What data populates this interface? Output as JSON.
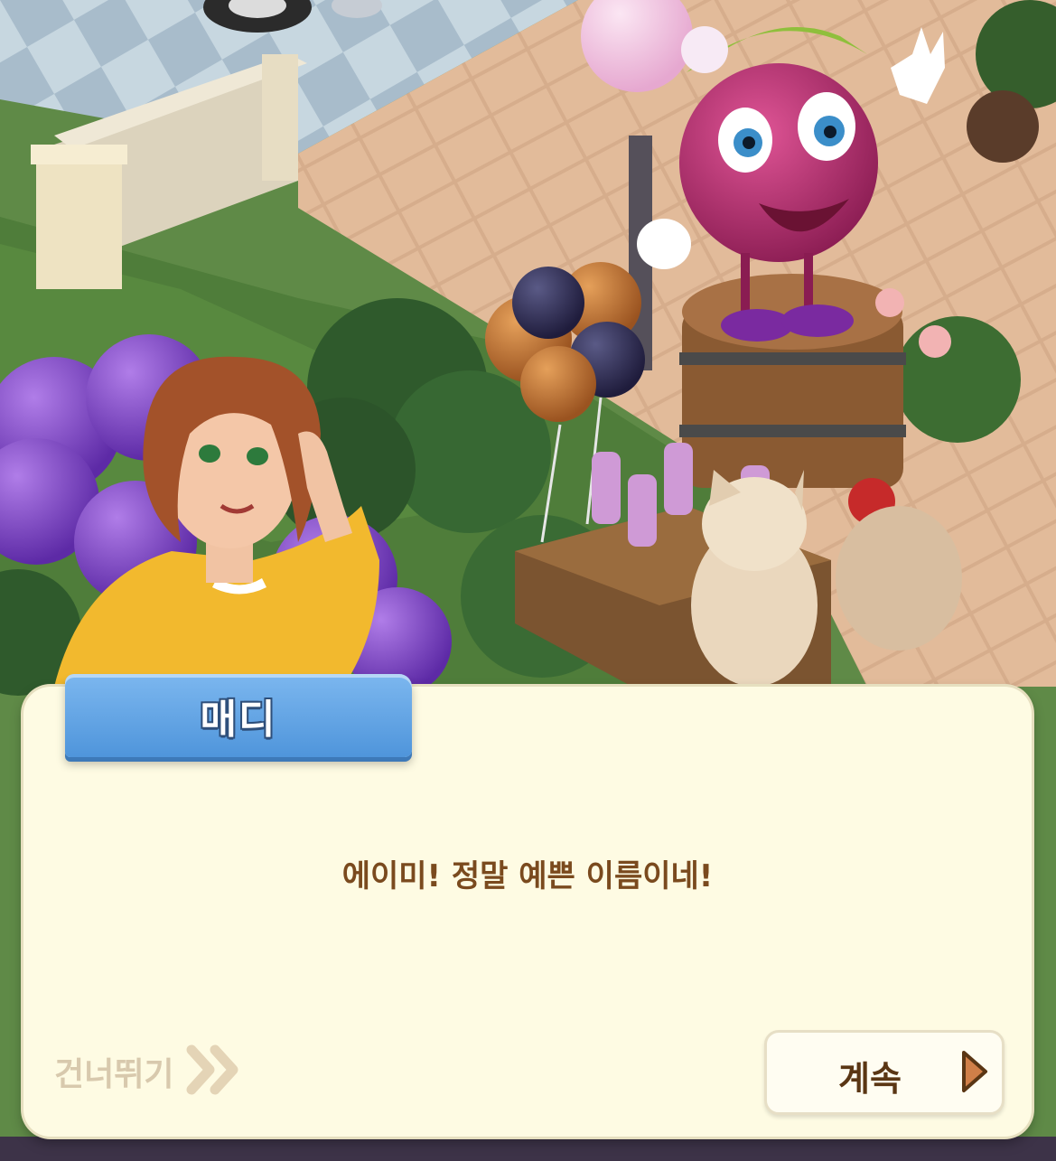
{
  "speaker": {
    "name": "매디"
  },
  "dialog": {
    "text": "에이미! 정말 예쁜 이름이네!"
  },
  "controls": {
    "skip_label": "건너뛰기",
    "continue_label": "계속"
  },
  "colors": {
    "dialog_bg": "#fefbe3",
    "name_tag": "#5c9fe2",
    "dialog_text": "#7a4a1e",
    "continue_arrow": "#d07f48",
    "skip_text": "#d8c9ad"
  },
  "icons": {
    "skip": "double-chevron-right-icon",
    "continue": "play-arrow-icon"
  }
}
